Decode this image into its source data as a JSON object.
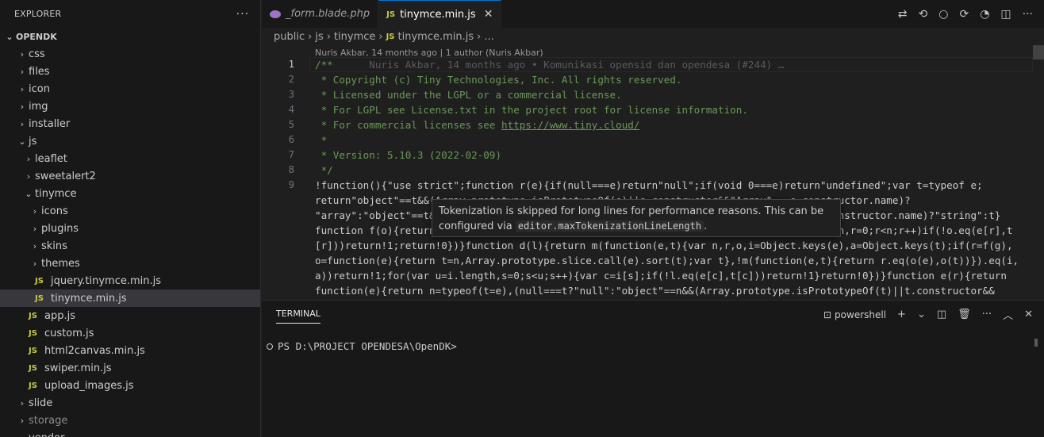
{
  "explorer": {
    "title": "EXPLORER",
    "more": "···",
    "root": "OPENDK",
    "items": [
      {
        "label": "css",
        "type": "folder",
        "depth": 1,
        "open": false
      },
      {
        "label": "files",
        "type": "folder",
        "depth": 1,
        "open": false
      },
      {
        "label": "icon",
        "type": "folder",
        "depth": 1,
        "open": false
      },
      {
        "label": "img",
        "type": "folder",
        "depth": 1,
        "open": false
      },
      {
        "label": "installer",
        "type": "folder",
        "depth": 1,
        "open": false
      },
      {
        "label": "js",
        "type": "folder",
        "depth": 1,
        "open": true
      },
      {
        "label": "leaflet",
        "type": "folder",
        "depth": 2,
        "open": false
      },
      {
        "label": "sweetalert2",
        "type": "folder",
        "depth": 2,
        "open": false
      },
      {
        "label": "tinymce",
        "type": "folder",
        "depth": 2,
        "open": true
      },
      {
        "label": "icons",
        "type": "folder",
        "depth": 3,
        "open": false
      },
      {
        "label": "plugins",
        "type": "folder",
        "depth": 3,
        "open": false
      },
      {
        "label": "skins",
        "type": "folder",
        "depth": 3,
        "open": false
      },
      {
        "label": "themes",
        "type": "folder",
        "depth": 3,
        "open": false
      },
      {
        "label": "jquery.tinymce.min.js",
        "type": "js",
        "depth": 3
      },
      {
        "label": "tinymce.min.js",
        "type": "js",
        "depth": 3,
        "selected": true
      },
      {
        "label": "app.js",
        "type": "js",
        "depth": 2
      },
      {
        "label": "custom.js",
        "type": "js",
        "depth": 2
      },
      {
        "label": "html2canvas.min.js",
        "type": "js",
        "depth": 2
      },
      {
        "label": "swiper.min.js",
        "type": "js",
        "depth": 2
      },
      {
        "label": "upload_images.js",
        "type": "js",
        "depth": 2
      },
      {
        "label": "slide",
        "type": "folder",
        "depth": 1,
        "open": false
      },
      {
        "label": "storage",
        "type": "folder",
        "depth": 1,
        "open": false,
        "dim": true
      },
      {
        "label": "vendor",
        "type": "folder",
        "depth": 1,
        "open": false
      }
    ]
  },
  "tabs": [
    {
      "label": "_form.blade.php",
      "icon": "php-icon",
      "active": false
    },
    {
      "label": "tinymce.min.js",
      "icon": "JS",
      "active": true,
      "close": "✕"
    }
  ],
  "breadcrumb": {
    "parts": [
      "public",
      "js",
      "tinymce"
    ],
    "file_badge": "JS",
    "file": "tinymce.min.js",
    "tail": "..."
  },
  "blame": "Nuris Akbar, 14 months ago | 1 author (Nuris Akbar)",
  "editor": {
    "line_numbers": [
      "1",
      "2",
      "3",
      "4",
      "5",
      "6",
      "7",
      "8",
      "9"
    ],
    "lines": [
      {
        "text": "/**",
        "kind": "comment",
        "ghost": "      Nuris Akbar, 14 months ago • Komunikasi opensid dan opendesa (#244) …"
      },
      {
        "text": " * Copyright (c) Tiny Technologies, Inc. All rights reserved.",
        "kind": "comment"
      },
      {
        "text": " * Licensed under the LGPL or a commercial license.",
        "kind": "comment"
      },
      {
        "text": " * For LGPL see License.txt in the project root for license information.",
        "kind": "comment"
      },
      {
        "text": " * For commercial licenses see ",
        "kind": "comment",
        "link": "https://www.tiny.cloud/"
      },
      {
        "text": " *",
        "kind": "comment"
      },
      {
        "text": " * Version: 5.10.3 (2022-02-09)",
        "kind": "comment"
      },
      {
        "text": " */",
        "kind": "comment"
      },
      {
        "text": "!function(){\"use strict\";function r(e){if(null===e)return\"null\";if(void 0===e)return\"undefined\";var t=typeof e;",
        "kind": "plain"
      },
      {
        "text": "return\"object\"==t&&(Array.prototype.isPrototypeOf(e)||e.constructor&&\"Array\"===e.constructor.name)?",
        "kind": "plain"
      },
      {
        "text": "\"array\":\"object\"==t&&(String.prototype.isPrototypeOf(e)||e.constructor&&\"String\"===e.constructor.name)?\"string\":t}",
        "kind": "plain"
      },
      {
        "text": "function f(o){return function(e){return r(e)===o}}function m(e,t){for(var n=0,r=e.length,r=0;r<n;r++)if(!o.eq(e[r],t",
        "kind": "plain"
      },
      {
        "text": "[r]))return!1;return!0})}function d(l){return m(function(e,t){var n,r,o,i=Object.keys(e),a=Object.keys(t);if(r=f(g),",
        "kind": "plain"
      },
      {
        "text": "o=function(e){return t=n,Array.prototype.slice.call(e).sort(t);var t},!m(function(e,t){return r.eq(o(e),o(t))}).eq(i,",
        "kind": "plain"
      },
      {
        "text": "a))return!1;for(var u=i.length,s=0;s<u;s++){var c=i[s];if(!l.eq(e[c],t[c]))return!1}return!0})}function e(r){return",
        "kind": "plain"
      },
      {
        "text": "function(e){return n=typeof(t=e),(null===t?\"null\":\"object\"==n&&(Array.prototype.isPrototypeOf(t)||t.constructor&&",
        "kind": "plain"
      }
    ]
  },
  "tooltip": {
    "line1": "Tokenization is skipped for long lines for performance reasons. This can be",
    "line2_prefix": "configured via ",
    "line2_code": "editor.maxTokenizationLineLength",
    "line2_suffix": "."
  },
  "panel": {
    "tab": "TERMINAL",
    "shell": "powershell",
    "prompt": "PS D:\\PROJECT OPENDESA\\OpenDK>"
  }
}
